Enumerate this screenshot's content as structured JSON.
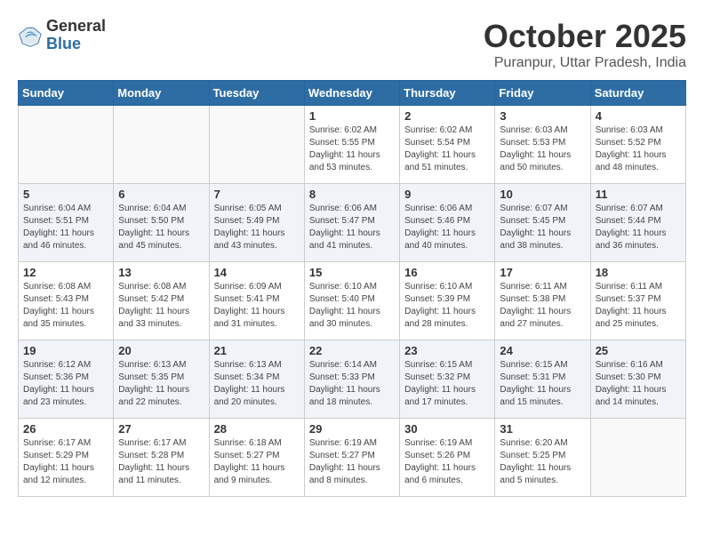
{
  "header": {
    "logo_general": "General",
    "logo_blue": "Blue",
    "month": "October 2025",
    "location": "Puranpur, Uttar Pradesh, India"
  },
  "weekdays": [
    "Sunday",
    "Monday",
    "Tuesday",
    "Wednesday",
    "Thursday",
    "Friday",
    "Saturday"
  ],
  "weeks": [
    [
      {
        "day": "",
        "info": ""
      },
      {
        "day": "",
        "info": ""
      },
      {
        "day": "",
        "info": ""
      },
      {
        "day": "1",
        "info": "Sunrise: 6:02 AM\nSunset: 5:55 PM\nDaylight: 11 hours\nand 53 minutes."
      },
      {
        "day": "2",
        "info": "Sunrise: 6:02 AM\nSunset: 5:54 PM\nDaylight: 11 hours\nand 51 minutes."
      },
      {
        "day": "3",
        "info": "Sunrise: 6:03 AM\nSunset: 5:53 PM\nDaylight: 11 hours\nand 50 minutes."
      },
      {
        "day": "4",
        "info": "Sunrise: 6:03 AM\nSunset: 5:52 PM\nDaylight: 11 hours\nand 48 minutes."
      }
    ],
    [
      {
        "day": "5",
        "info": "Sunrise: 6:04 AM\nSunset: 5:51 PM\nDaylight: 11 hours\nand 46 minutes."
      },
      {
        "day": "6",
        "info": "Sunrise: 6:04 AM\nSunset: 5:50 PM\nDaylight: 11 hours\nand 45 minutes."
      },
      {
        "day": "7",
        "info": "Sunrise: 6:05 AM\nSunset: 5:49 PM\nDaylight: 11 hours\nand 43 minutes."
      },
      {
        "day": "8",
        "info": "Sunrise: 6:06 AM\nSunset: 5:47 PM\nDaylight: 11 hours\nand 41 minutes."
      },
      {
        "day": "9",
        "info": "Sunrise: 6:06 AM\nSunset: 5:46 PM\nDaylight: 11 hours\nand 40 minutes."
      },
      {
        "day": "10",
        "info": "Sunrise: 6:07 AM\nSunset: 5:45 PM\nDaylight: 11 hours\nand 38 minutes."
      },
      {
        "day": "11",
        "info": "Sunrise: 6:07 AM\nSunset: 5:44 PM\nDaylight: 11 hours\nand 36 minutes."
      }
    ],
    [
      {
        "day": "12",
        "info": "Sunrise: 6:08 AM\nSunset: 5:43 PM\nDaylight: 11 hours\nand 35 minutes."
      },
      {
        "day": "13",
        "info": "Sunrise: 6:08 AM\nSunset: 5:42 PM\nDaylight: 11 hours\nand 33 minutes."
      },
      {
        "day": "14",
        "info": "Sunrise: 6:09 AM\nSunset: 5:41 PM\nDaylight: 11 hours\nand 31 minutes."
      },
      {
        "day": "15",
        "info": "Sunrise: 6:10 AM\nSunset: 5:40 PM\nDaylight: 11 hours\nand 30 minutes."
      },
      {
        "day": "16",
        "info": "Sunrise: 6:10 AM\nSunset: 5:39 PM\nDaylight: 11 hours\nand 28 minutes."
      },
      {
        "day": "17",
        "info": "Sunrise: 6:11 AM\nSunset: 5:38 PM\nDaylight: 11 hours\nand 27 minutes."
      },
      {
        "day": "18",
        "info": "Sunrise: 6:11 AM\nSunset: 5:37 PM\nDaylight: 11 hours\nand 25 minutes."
      }
    ],
    [
      {
        "day": "19",
        "info": "Sunrise: 6:12 AM\nSunset: 5:36 PM\nDaylight: 11 hours\nand 23 minutes."
      },
      {
        "day": "20",
        "info": "Sunrise: 6:13 AM\nSunset: 5:35 PM\nDaylight: 11 hours\nand 22 minutes."
      },
      {
        "day": "21",
        "info": "Sunrise: 6:13 AM\nSunset: 5:34 PM\nDaylight: 11 hours\nand 20 minutes."
      },
      {
        "day": "22",
        "info": "Sunrise: 6:14 AM\nSunset: 5:33 PM\nDaylight: 11 hours\nand 18 minutes."
      },
      {
        "day": "23",
        "info": "Sunrise: 6:15 AM\nSunset: 5:32 PM\nDaylight: 11 hours\nand 17 minutes."
      },
      {
        "day": "24",
        "info": "Sunrise: 6:15 AM\nSunset: 5:31 PM\nDaylight: 11 hours\nand 15 minutes."
      },
      {
        "day": "25",
        "info": "Sunrise: 6:16 AM\nSunset: 5:30 PM\nDaylight: 11 hours\nand 14 minutes."
      }
    ],
    [
      {
        "day": "26",
        "info": "Sunrise: 6:17 AM\nSunset: 5:29 PM\nDaylight: 11 hours\nand 12 minutes."
      },
      {
        "day": "27",
        "info": "Sunrise: 6:17 AM\nSunset: 5:28 PM\nDaylight: 11 hours\nand 11 minutes."
      },
      {
        "day": "28",
        "info": "Sunrise: 6:18 AM\nSunset: 5:27 PM\nDaylight: 11 hours\nand 9 minutes."
      },
      {
        "day": "29",
        "info": "Sunrise: 6:19 AM\nSunset: 5:27 PM\nDaylight: 11 hours\nand 8 minutes."
      },
      {
        "day": "30",
        "info": "Sunrise: 6:19 AM\nSunset: 5:26 PM\nDaylight: 11 hours\nand 6 minutes."
      },
      {
        "day": "31",
        "info": "Sunrise: 6:20 AM\nSunset: 5:25 PM\nDaylight: 11 hours\nand 5 minutes."
      },
      {
        "day": "",
        "info": ""
      }
    ]
  ]
}
